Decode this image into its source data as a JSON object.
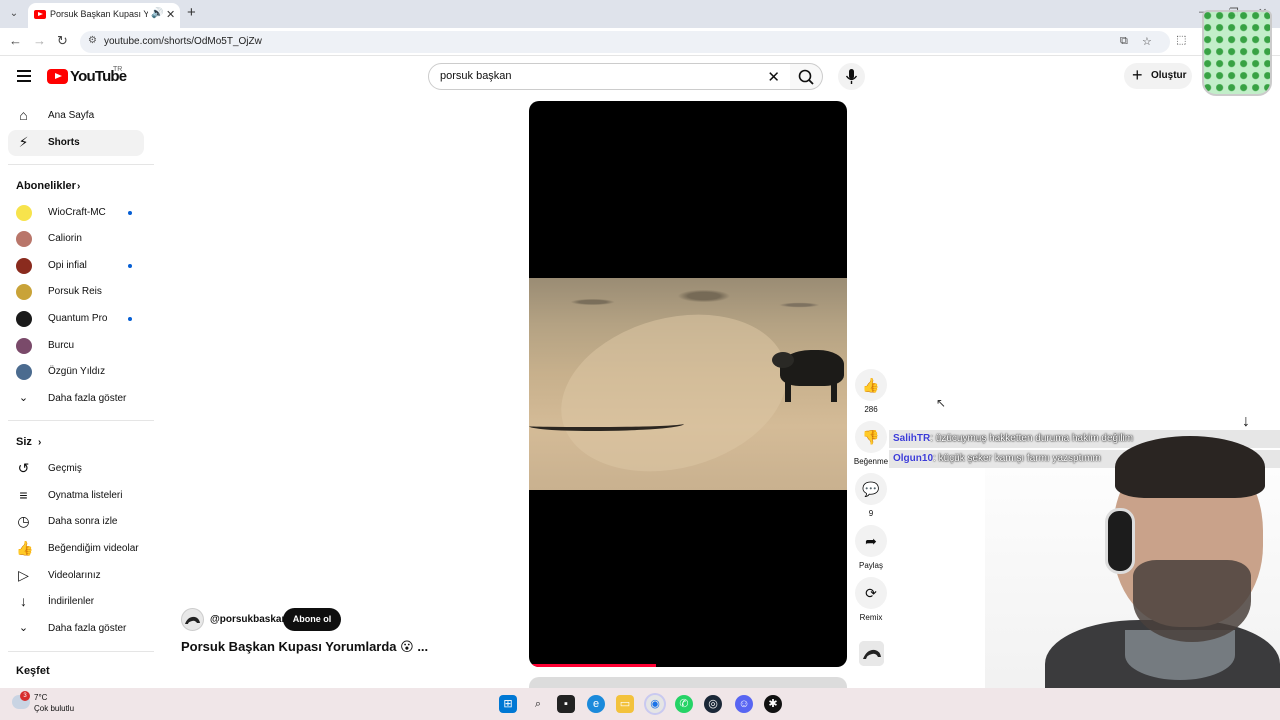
{
  "browser": {
    "tab_title": "Porsuk Başkan Kupası Yorumlarda",
    "tab_audio_icon": "speaker-icon",
    "url": "youtube.com/shorts/OdMo5T_OjZw"
  },
  "header": {
    "logo_text": "YouTube",
    "logo_country": "TR",
    "search_value": "porsuk başkan",
    "create_label": "Oluştur"
  },
  "sidebar": {
    "main": [
      {
        "label": "Ana Sayfa",
        "icon": "home-icon"
      },
      {
        "label": "Shorts",
        "icon": "shorts-icon",
        "active": true
      }
    ],
    "subscriptions_title": "Abonelikler",
    "subscriptions": [
      {
        "label": "WioCraft-MC",
        "color": "#f7e34c",
        "dot": true
      },
      {
        "label": "Caliorin",
        "color": "#b9766a",
        "dot": false
      },
      {
        "label": "Opi infial",
        "color": "#8a2b1e",
        "dot": true
      },
      {
        "label": "Porsuk Reis",
        "color": "#c9a338",
        "dot": false
      },
      {
        "label": "Quantum Pro",
        "color": "#1a1a1a",
        "dot": true
      },
      {
        "label": "Burcu",
        "color": "#7a4a6a",
        "dot": false
      },
      {
        "label": "Özgün Yıldız",
        "color": "#4b6b8f",
        "dot": false
      }
    ],
    "show_more": "Daha fazla göster",
    "you_title": "Siz",
    "you_items": [
      {
        "label": "Geçmiş",
        "icon": "history-icon"
      },
      {
        "label": "Oynatma listeleri",
        "icon": "playlist-icon"
      },
      {
        "label": "Daha sonra izle",
        "icon": "clock-icon"
      },
      {
        "label": "Beğendiğim videolar",
        "icon": "like-icon"
      },
      {
        "label": "Videolarınız",
        "icon": "video-icon"
      },
      {
        "label": "İndirilenler",
        "icon": "download-icon"
      }
    ],
    "show_more_2": "Daha fazla göster",
    "explore_title": "Keşfet"
  },
  "short": {
    "channel": "@porsukbaskan",
    "subscribe_label": "Abone ol",
    "title": "Porsuk Başkan Kupası Yorumlarda 😮 ...",
    "progress": 0.4,
    "accent": "#ff0033"
  },
  "actions": {
    "like_count": "286",
    "dislike_label": "Beğenme",
    "comment_count": "9",
    "share_label": "Paylaş",
    "remix_label": "Remix"
  },
  "chat": [
    {
      "user": "SalihTR",
      "message": ": üzücuymuş hakketten duruma hakim değilim"
    },
    {
      "user": "Olgun10",
      "message": ": küçük şeker kamışı farmı yazsptımm"
    }
  ],
  "taskbar": {
    "temperature": "7°C",
    "weather": "Çok bulutlu",
    "notification_count": "3"
  }
}
